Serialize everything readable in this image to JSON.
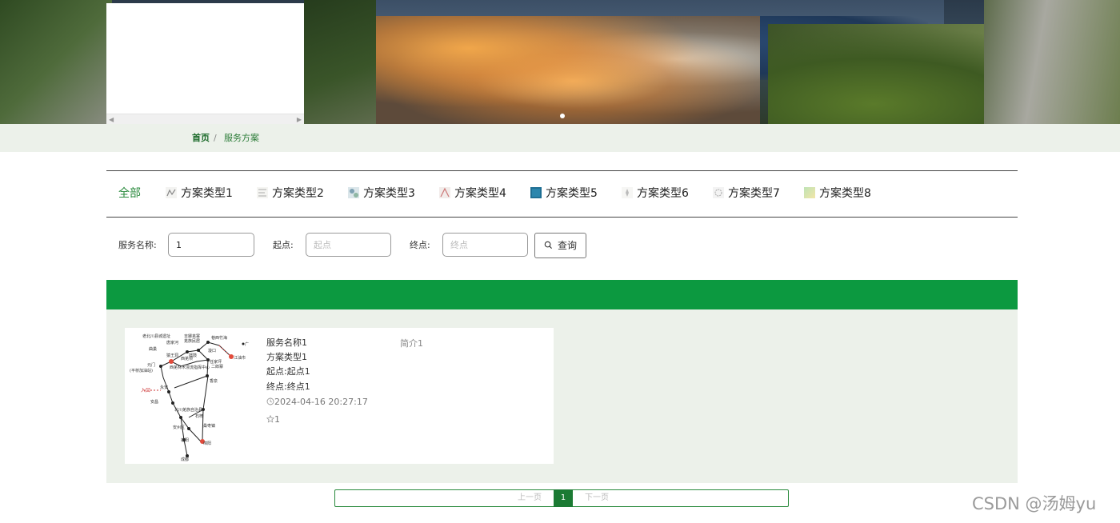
{
  "breadcrumb": {
    "home": "首页",
    "separator": "/",
    "current": "服务方案"
  },
  "categories": [
    {
      "label": "全部",
      "icon": ""
    },
    {
      "label": "方案类型1",
      "icon": "thumbnail-icon"
    },
    {
      "label": "方案类型2",
      "icon": "thumbnail-icon"
    },
    {
      "label": "方案类型3",
      "icon": "thumbnail-icon"
    },
    {
      "label": "方案类型4",
      "icon": "thumbnail-icon"
    },
    {
      "label": "方案类型5",
      "icon": "thumbnail-icon"
    },
    {
      "label": "方案类型6",
      "icon": "thumbnail-icon"
    },
    {
      "label": "方案类型7",
      "icon": "thumbnail-icon"
    },
    {
      "label": "方案类型8",
      "icon": "thumbnail-icon"
    }
  ],
  "search": {
    "name_label": "服务名称:",
    "name_value": "1",
    "start_label": "起点:",
    "start_placeholder": "起点",
    "end_label": "终点:",
    "end_placeholder": "终点",
    "button_label": "查询"
  },
  "card": {
    "name": "服务名称1",
    "type": "方案类型1",
    "start": "起点:起点1",
    "end": "终点:终点1",
    "time": "2024-04-16 20:27:17",
    "likes": "1",
    "intro": "简介1",
    "map_labels": [
      "老北川县城遗址",
      "曲巢",
      "吉娜羌寨",
      "羌族民居",
      "巷西竹海",
      "唐家河",
      "猿王洞",
      "擂鼓",
      "漩口",
      "西羌坝",
      "任家坪",
      "元门",
      "(平桥加油站)",
      "西羌林木漂流指挥中心",
      "二郎寨",
      "江油市",
      "广元",
      "入口",
      "永安",
      "香泉",
      "安昌",
      "北川羌族自治县",
      "石椅",
      "安州区",
      "桑枣镇",
      "德阳",
      "绵阳",
      "成都"
    ]
  },
  "pager": {
    "prev": "上一页",
    "page": "1",
    "next": "下一页"
  },
  "watermark": "CSDN @汤姆yu",
  "colors": {
    "primary_green": "#0c9940",
    "breadcrumb_bg": "#ecf1ea",
    "active_tab": "#2a8a3d"
  }
}
